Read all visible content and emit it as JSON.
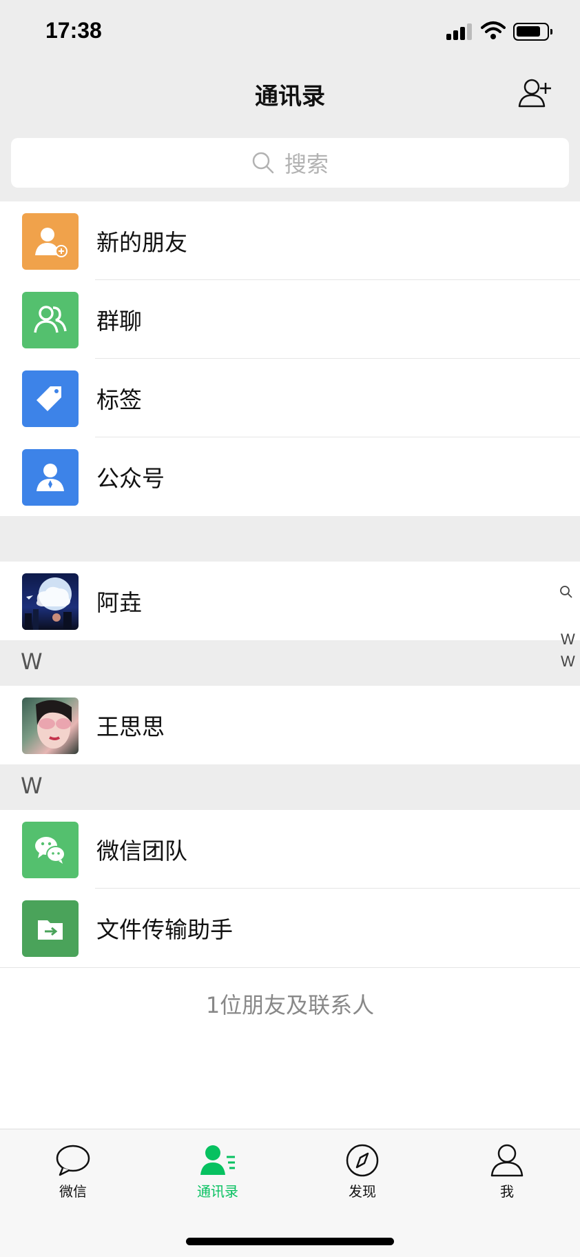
{
  "status_bar": {
    "time": "17:38"
  },
  "nav": {
    "title": "通讯录"
  },
  "search": {
    "placeholder": "搜索"
  },
  "functions": [
    {
      "label": "新的朋友",
      "icon": "add-friend-icon",
      "color": "#f0a24b"
    },
    {
      "label": "群聊",
      "icon": "group-chat-icon",
      "color": "#54c06e"
    },
    {
      "label": "标签",
      "icon": "tag-icon",
      "color": "#3d83e8"
    },
    {
      "label": "公众号",
      "icon": "official-account-icon",
      "color": "#3d83e8"
    }
  ],
  "contacts": {
    "top": {
      "name": "阿垚"
    },
    "section_w1": {
      "letter": "W",
      "items": [
        {
          "name": "王思思"
        }
      ]
    },
    "section_w2": {
      "letter": "W",
      "items": [
        {
          "name": "微信团队",
          "icon": "wechat-team-icon",
          "color": "#54c06e"
        },
        {
          "name": "文件传输助手",
          "icon": "file-transfer-icon",
          "color": "#4aa35a"
        }
      ]
    }
  },
  "footer": {
    "count_text": "1位朋友及联系人"
  },
  "index": {
    "letters": [
      "W",
      "W"
    ]
  },
  "tabs": [
    {
      "label": "微信",
      "icon": "chat-icon"
    },
    {
      "label": "通讯录",
      "icon": "contacts-icon",
      "active": true
    },
    {
      "label": "发现",
      "icon": "discover-icon"
    },
    {
      "label": "我",
      "icon": "me-icon"
    }
  ],
  "colors": {
    "accent": "#07c160",
    "background": "#ededed"
  }
}
